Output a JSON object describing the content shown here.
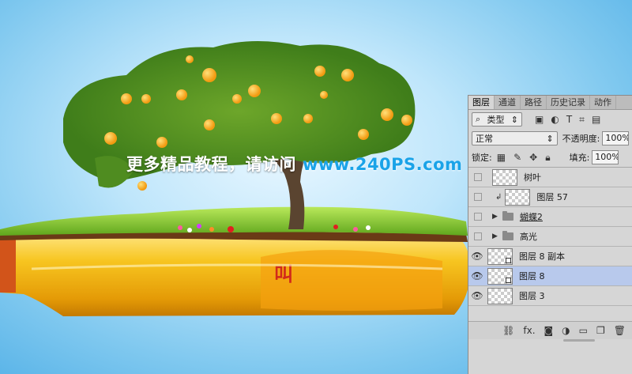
{
  "watermark": {
    "text": "更多精品教程，请访问",
    "url": "www.240PS.com"
  },
  "colors": {
    "accent_url": "#1aa3e8",
    "selection": "#b8c9ec",
    "panel_bg": "#d6d6d6"
  },
  "layers_panel": {
    "tabs": [
      {
        "label": "图层",
        "active": true
      },
      {
        "label": "通道",
        "active": false
      },
      {
        "label": "路径",
        "active": false
      },
      {
        "label": "历史记录",
        "active": false
      },
      {
        "label": "动作",
        "active": false
      }
    ],
    "filter": {
      "label": "类型",
      "icons": [
        "image-filter-icon",
        "adjustment-filter-icon",
        "text-filter-icon",
        "shape-filter-icon",
        "smart-object-filter-icon"
      ]
    },
    "blend_mode": "正常",
    "opacity": {
      "label": "不透明度:",
      "value": "100%"
    },
    "lock": {
      "label": "锁定:",
      "icons": [
        "lock-transparent-icon",
        "lock-paint-icon",
        "lock-move-icon",
        "lock-all-icon"
      ]
    },
    "fill": {
      "label": "填充:",
      "value": "100%"
    },
    "layers": [
      {
        "name": "树叶",
        "visible": false,
        "type": "layer",
        "selected": false
      },
      {
        "name": "图层 57",
        "visible": false,
        "type": "clipped-layer",
        "selected": false
      },
      {
        "name": "蝴蝶2",
        "visible": false,
        "type": "group",
        "selected": false
      },
      {
        "name": "高光",
        "visible": false,
        "type": "group",
        "selected": false
      },
      {
        "name": "图层 8 副本",
        "visible": true,
        "type": "smart-object",
        "selected": false
      },
      {
        "name": "图层 8",
        "visible": true,
        "type": "smart-object",
        "selected": true
      },
      {
        "name": "图层 3",
        "visible": true,
        "type": "layer",
        "selected": false
      }
    ],
    "bottom_icons": [
      "link-icon",
      "fx-icon",
      "mask-icon",
      "adjustment-icon",
      "group-icon",
      "new-layer-icon",
      "trash-icon"
    ],
    "fx_label": "fx."
  }
}
